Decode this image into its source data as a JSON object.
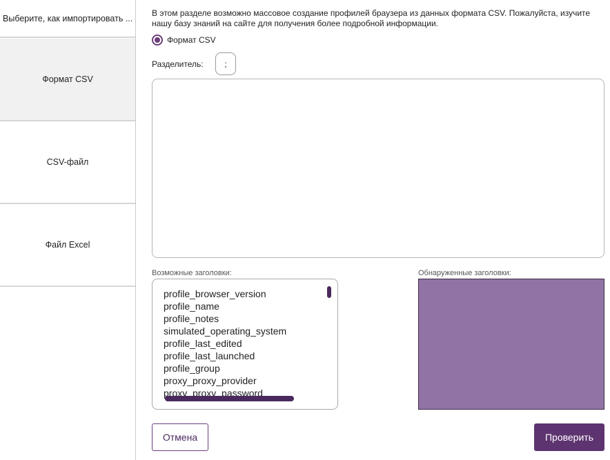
{
  "sidebar": {
    "header": "Выберите, как импортировать ...",
    "items": [
      {
        "label": "Формат CSV"
      },
      {
        "label": "CSV-файл"
      },
      {
        "label": "Файл Excel"
      }
    ]
  },
  "main": {
    "intro": "В этом разделе возможно массовое создание профилей браузера из данных формата CSV. Пожалуйста, изучите нашу базу знаний на сайте для получения более подробной информации.",
    "radio_label": "Формат CSV",
    "separator_label": "Разделитель:",
    "separator_value": ";",
    "csv_input_value": "",
    "possible_headers_label": "Возможные заголовки:",
    "possible_headers": [
      "profile_browser_version",
      "profile_name",
      "profile_notes",
      "simulated_operating_system",
      "profile_last_edited",
      "profile_last_launched",
      "profile_group",
      "proxy_proxy_provider",
      "proxy_proxy_password"
    ],
    "detected_headers_label": "Обнаруженные заголовки:"
  },
  "buttons": {
    "cancel": "Отмена",
    "check": "Проверить"
  },
  "colors": {
    "accent": "#5e3470",
    "detected_fill": "#9174a5"
  }
}
